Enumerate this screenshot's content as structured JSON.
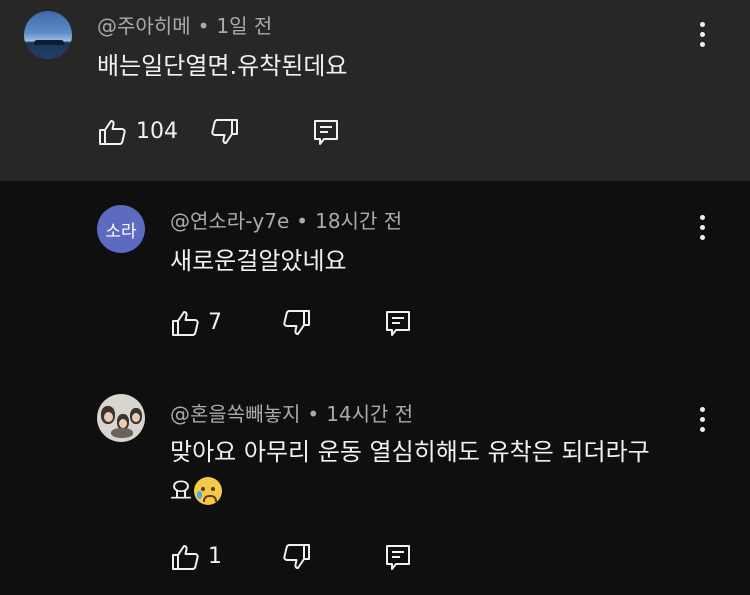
{
  "comments": [
    {
      "author": "@주아히메",
      "time": "1일 전",
      "text": "배는일단열면.유착된데요",
      "likes": "104"
    },
    {
      "avatar_initials": "소라",
      "author": "@연소라-y7e",
      "time": "18시간 전",
      "text": "새로운걸알았네요",
      "likes": "7"
    },
    {
      "author": "@혼을쏙빼놓지",
      "time": "14시간 전",
      "text_line1": "맞아요 아무리 운동 열심히해도 유착은 되더라구",
      "text_line2": "요",
      "emoji": "crying-face",
      "likes": "1"
    }
  ],
  "separator": "•",
  "colors": {
    "parent_bg": "#272727",
    "page_bg": "#0f0f0f",
    "avatar_initial_bg": "#5c6bc0",
    "meta_text": "#aaaaaa"
  }
}
